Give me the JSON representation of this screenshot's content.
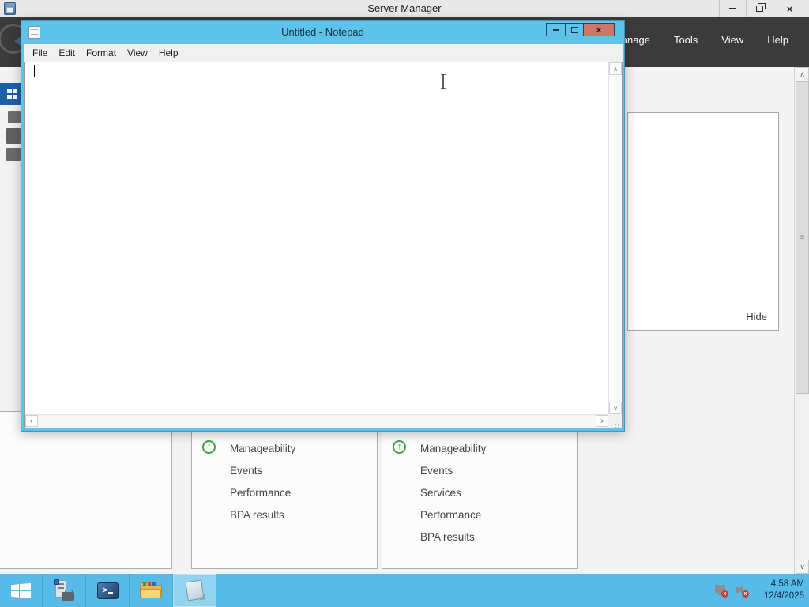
{
  "server_manager": {
    "window_title": "Server Manager",
    "menu": [
      "Manage",
      "Tools",
      "View",
      "Help"
    ],
    "flyout": {
      "hide_label": "Hide"
    },
    "tiles": [
      {
        "heading": "Manageability",
        "items": [
          "Events",
          "Performance",
          "BPA results"
        ]
      },
      {
        "heading": "Manageability",
        "items": [
          "Events",
          "Services",
          "Performance",
          "BPA results"
        ]
      }
    ]
  },
  "notepad": {
    "window_title": "Untitled - Notepad",
    "menu": [
      "File",
      "Edit",
      "Format",
      "View",
      "Help"
    ],
    "editor_text": ""
  },
  "taskbar": {
    "clock": {
      "time": "4:58 AM",
      "date": "12/4/2025"
    }
  },
  "icons": {
    "close_glyph": "×",
    "scroll_up": "∧",
    "scroll_down": "∨",
    "scroll_left": "‹",
    "scroll_right": "›",
    "thumb_grip": "≡",
    "status_up_arrow": "↑",
    "badge_x": "x"
  },
  "colors": {
    "accent_cyan": "#5fc2e8",
    "taskbar_cyan": "#56bbe6",
    "banner_dark": "#3b3b3b",
    "nav_selected_blue": "#1e60a8",
    "close_button_red": "#d0756c",
    "status_green": "#3aaa35"
  }
}
